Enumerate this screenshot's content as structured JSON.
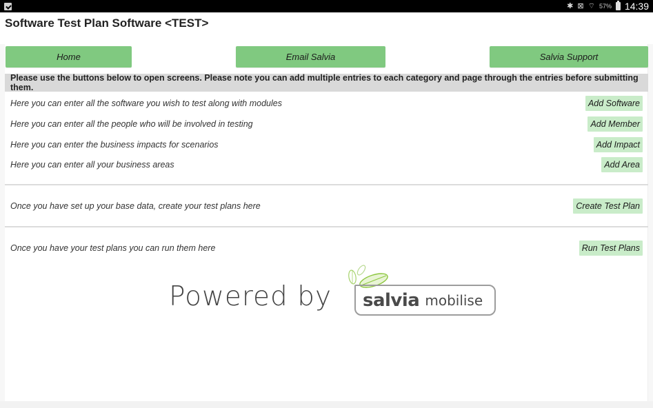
{
  "status_bar": {
    "left_icon": "clipboard-check-icon",
    "icons": [
      "bluetooth-icon",
      "vibrate-mute-icon",
      "wifi-icon"
    ],
    "battery_percent": "57%",
    "time": "14:39"
  },
  "app": {
    "title": "Software Test Plan Software <TEST>"
  },
  "nav": {
    "home": "Home",
    "email": "Email Salvia",
    "support": "Salvia Support"
  },
  "banner": "Please use the buttons below to open screens. Please note you can add multiple entries to each category and page through the entries before submitting them.",
  "base_data_rows": [
    {
      "text": "Here you can enter all the software you wish to test along with modules",
      "button": "Add Software"
    },
    {
      "text": "Here you can enter all the people who will be involved in testing",
      "button": "Add Member"
    },
    {
      "text": "Here you can enter the business impacts for scenarios",
      "button": "Add Impact"
    },
    {
      "text": "Here you can enter all your business areas",
      "button": "Add Area"
    }
  ],
  "create_row": {
    "text": "Once you have set up your base data, create your test plans here",
    "button": "Create Test Plan"
  },
  "run_row": {
    "text": "Once you have your test plans you can run them here",
    "button": "Run Test Plans"
  },
  "footer_logo": {
    "powered_by": "Powered by",
    "brand_primary": "salvia",
    "brand_secondary": "mobilise",
    "leaf_color": "#8cc63f"
  },
  "colors": {
    "nav_button": "#80c980",
    "action_button": "#c9ecc9",
    "banner": "#d9d9d9"
  }
}
